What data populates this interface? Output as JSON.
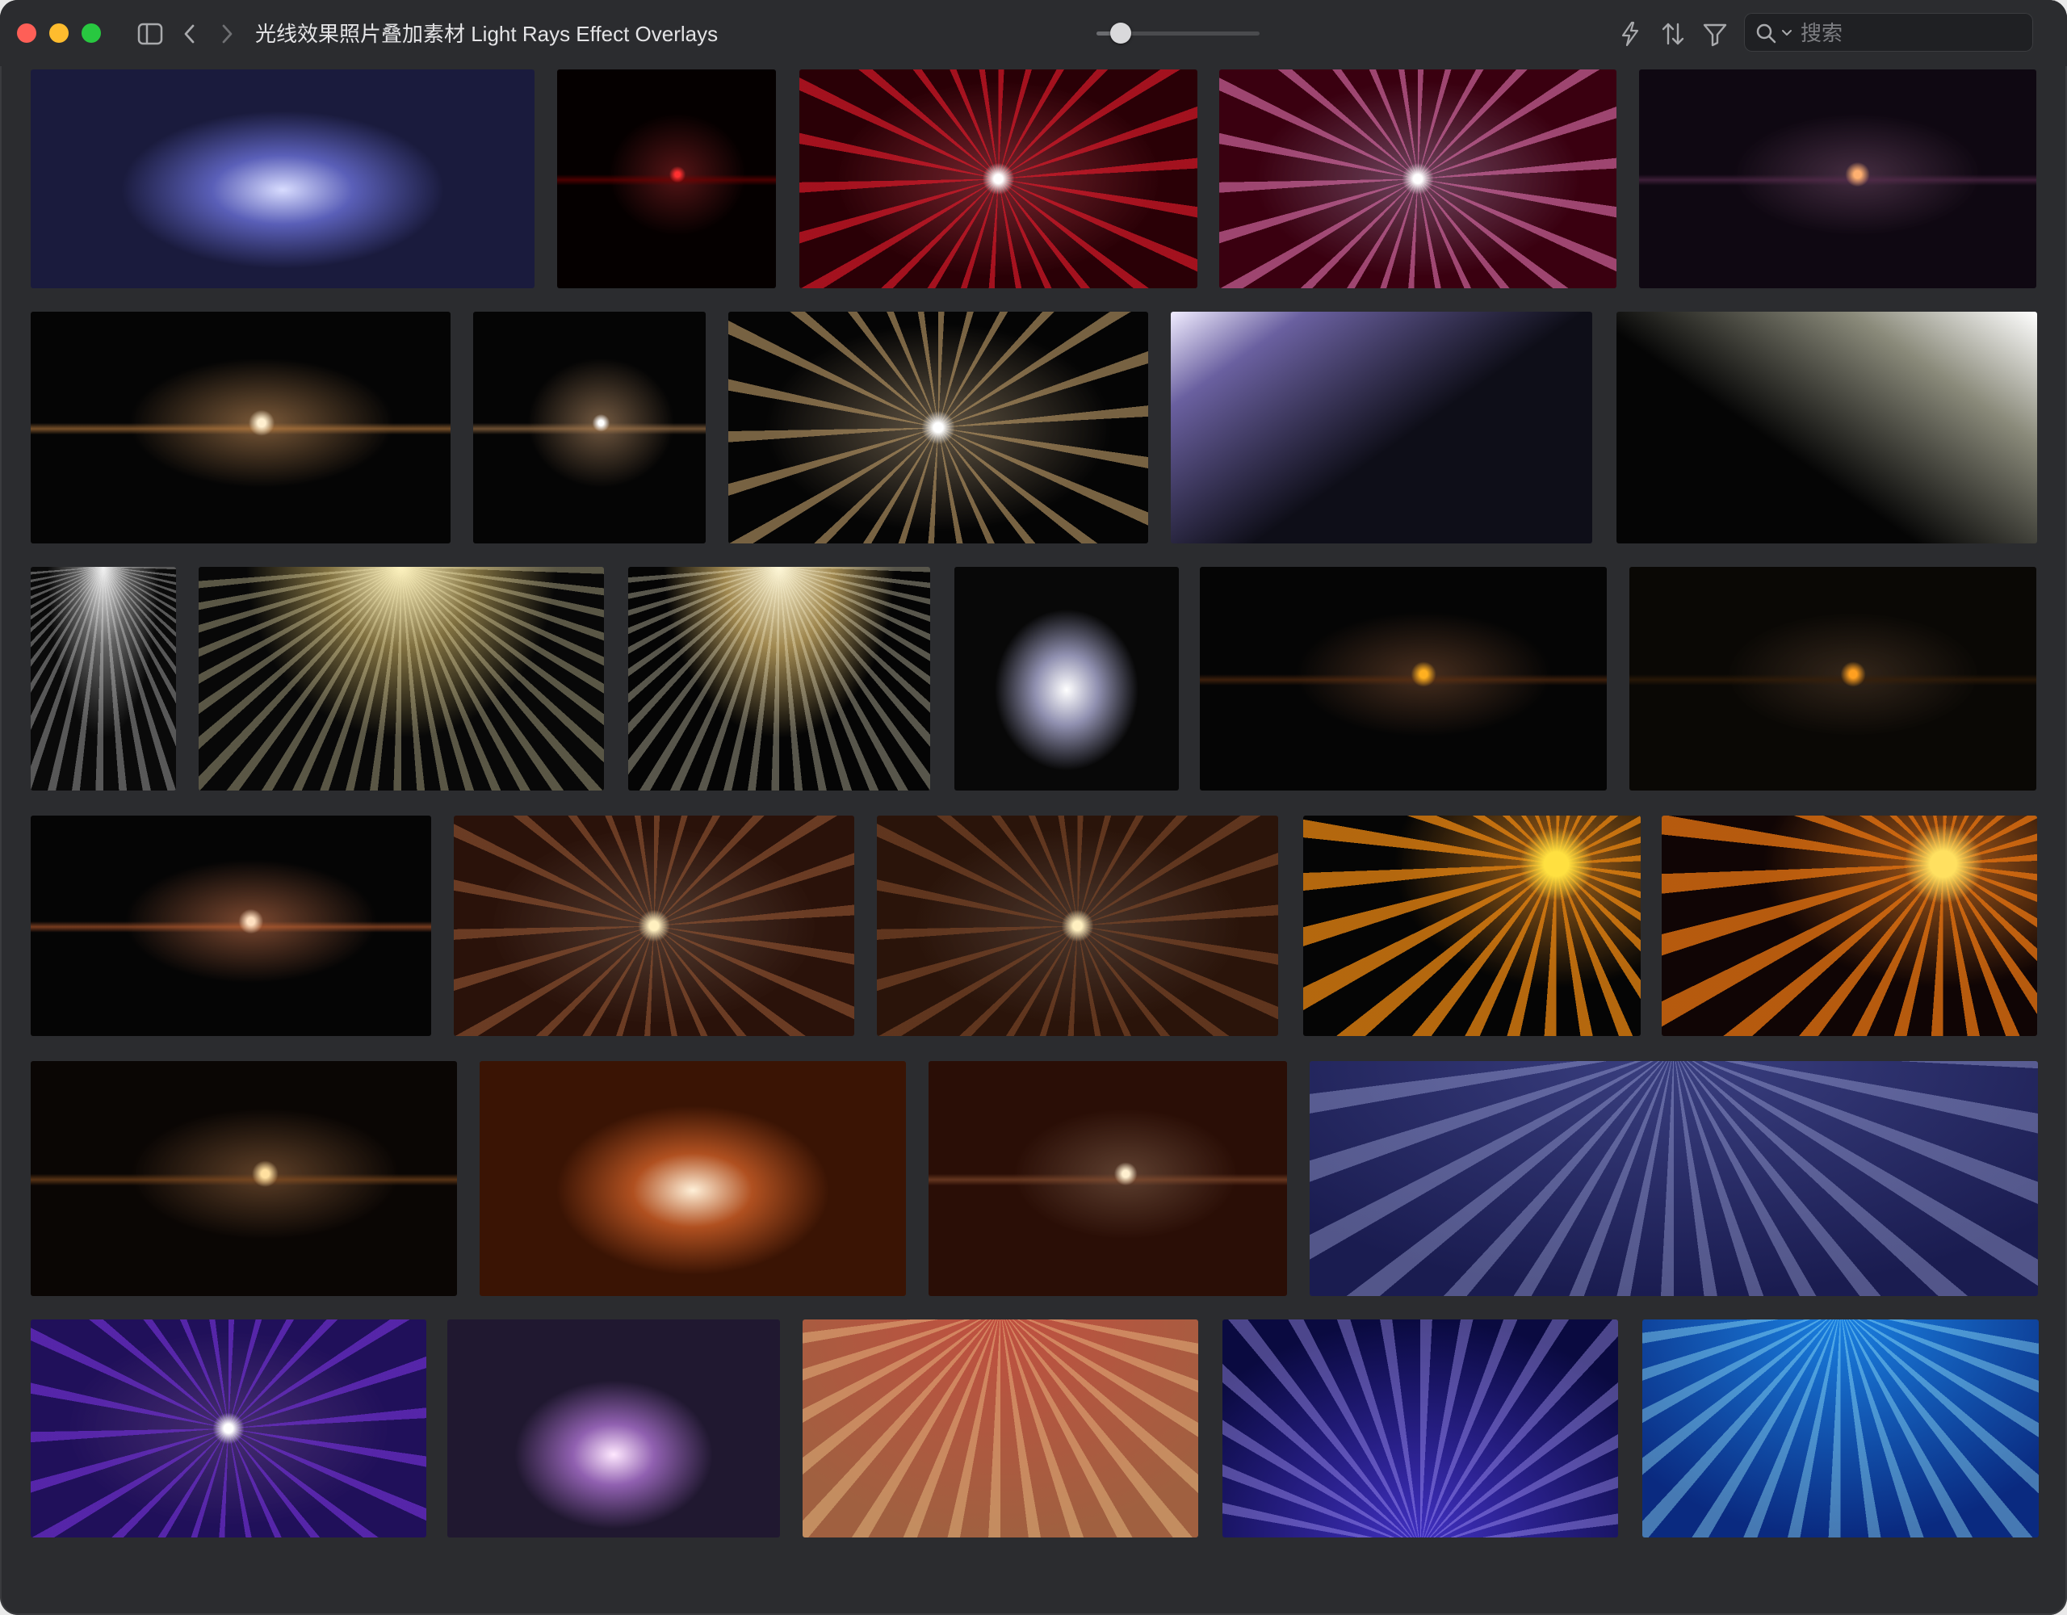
{
  "window": {
    "title": "光线效果照片叠加素材 Light Rays Effect Overlays",
    "zoom_level": 0.15,
    "search": {
      "placeholder": "搜索",
      "value": ""
    }
  },
  "toolbar": {
    "icons": [
      "sidebar-toggle-icon",
      "back-icon",
      "forward-icon",
      "bolt-icon",
      "sort-icon",
      "filter-icon",
      "search-icon",
      "chevron-down-icon"
    ]
  },
  "thumbnails": [
    {
      "name": "blue-flare-soft",
      "colors": [
        "#d8dcff",
        "#5a5fb8",
        "#1a1b3d"
      ],
      "style": "glow"
    },
    {
      "name": "red-star-small",
      "colors": [
        "#ff3030",
        "#7a0000",
        "#050000"
      ],
      "style": "star"
    },
    {
      "name": "red-burst",
      "colors": [
        "#ffffff",
        "#e01a2a",
        "#2a0006"
      ],
      "style": "burst"
    },
    {
      "name": "rainbow-burst",
      "colors": [
        "#ffffff",
        "#d068a0",
        "#3a0010"
      ],
      "style": "burst"
    },
    {
      "name": "purple-glow-dim",
      "colors": [
        "#ffb070",
        "#5a2d50",
        "#0f0812"
      ],
      "style": "star"
    },
    {
      "name": "gold-horizontal-star",
      "colors": [
        "#fff0d0",
        "#c08040",
        "#050505"
      ],
      "style": "star"
    },
    {
      "name": "gold-star-small",
      "colors": [
        "#ffffff",
        "#b08050",
        "#050505"
      ],
      "style": "star"
    },
    {
      "name": "white-gold-burst",
      "colors": [
        "#ffffff",
        "#b09060",
        "#050505"
      ],
      "style": "burst"
    },
    {
      "name": "lavender-beam",
      "colors": [
        "#f0ecff",
        "#6a60a0",
        "#0e0e18"
      ],
      "style": "beam-tl"
    },
    {
      "name": "white-diagonal-rays",
      "colors": [
        "#ffffff",
        "#8a8a7a",
        "#050505"
      ],
      "style": "beam-tr"
    },
    {
      "name": "white-spotlight",
      "colors": [
        "#f4f4f4",
        "#606060",
        "#0a0a0a"
      ],
      "style": "spot"
    },
    {
      "name": "gold-spotlight-wide",
      "colors": [
        "#fff4c0",
        "#807040",
        "#080808"
      ],
      "style": "spot"
    },
    {
      "name": "gold-spotlight-narrow",
      "colors": [
        "#fff8d8",
        "#a08850",
        "#050505"
      ],
      "style": "spot"
    },
    {
      "name": "white-orb",
      "colors": [
        "#ffffff",
        "#9090b0",
        "#080808"
      ],
      "style": "glow"
    },
    {
      "name": "orange-streak-prism",
      "colors": [
        "#ffb020",
        "#603010",
        "#050505"
      ],
      "style": "star"
    },
    {
      "name": "orange-star-dim",
      "colors": [
        "#ffa020",
        "#3a2008",
        "#0a0805"
      ],
      "style": "star"
    },
    {
      "name": "orange-flare-ghost",
      "colors": [
        "#ffe0c0",
        "#c06030",
        "#050505"
      ],
      "style": "star"
    },
    {
      "name": "brown-warm-star-a",
      "colors": [
        "#fff0c0",
        "#8a5030",
        "#2a120a"
      ],
      "style": "burst"
    },
    {
      "name": "brown-warm-star-b",
      "colors": [
        "#fff0c0",
        "#7a4628",
        "#2a140a"
      ],
      "style": "burst"
    },
    {
      "name": "orange-sun-burst-a",
      "colors": [
        "#ffe040",
        "#e08010",
        "#050505"
      ],
      "style": "sun"
    },
    {
      "name": "orange-sun-burst-b",
      "colors": [
        "#ffe060",
        "#e07010",
        "#100505"
      ],
      "style": "sun"
    },
    {
      "name": "amber-star-dark",
      "colors": [
        "#ffe0a0",
        "#8a5020",
        "#0a0604"
      ],
      "style": "star"
    },
    {
      "name": "peach-orb-ghost",
      "colors": [
        "#fff0d8",
        "#b05020",
        "#3a1404"
      ],
      "style": "glow"
    },
    {
      "name": "amber-star-brown",
      "colors": [
        "#fff0d0",
        "#8a5030",
        "#2a0e06"
      ],
      "style": "star"
    },
    {
      "name": "navy-rays",
      "colors": [
        "#a8aee0",
        "#3a3f80",
        "#1a1c50"
      ],
      "style": "rays-top"
    },
    {
      "name": "violet-burst",
      "colors": [
        "#ffffff",
        "#7030d0",
        "#20105a"
      ],
      "style": "burst"
    },
    {
      "name": "violet-orb-column",
      "colors": [
        "#ffe8ff",
        "#9060b0",
        "#201830"
      ],
      "style": "glow-low"
    },
    {
      "name": "peach-rays",
      "colors": [
        "#f8d090",
        "#c05040",
        "#a06040"
      ],
      "style": "rays-top"
    },
    {
      "name": "blue-violet-rays",
      "colors": [
        "#b0a0ff",
        "#4030c0",
        "#0a0a40"
      ],
      "style": "rays-bottom"
    },
    {
      "name": "cyan-rays",
      "colors": [
        "#a0f0ff",
        "#1a80e0",
        "#0a2a80"
      ],
      "style": "rays-top"
    }
  ]
}
